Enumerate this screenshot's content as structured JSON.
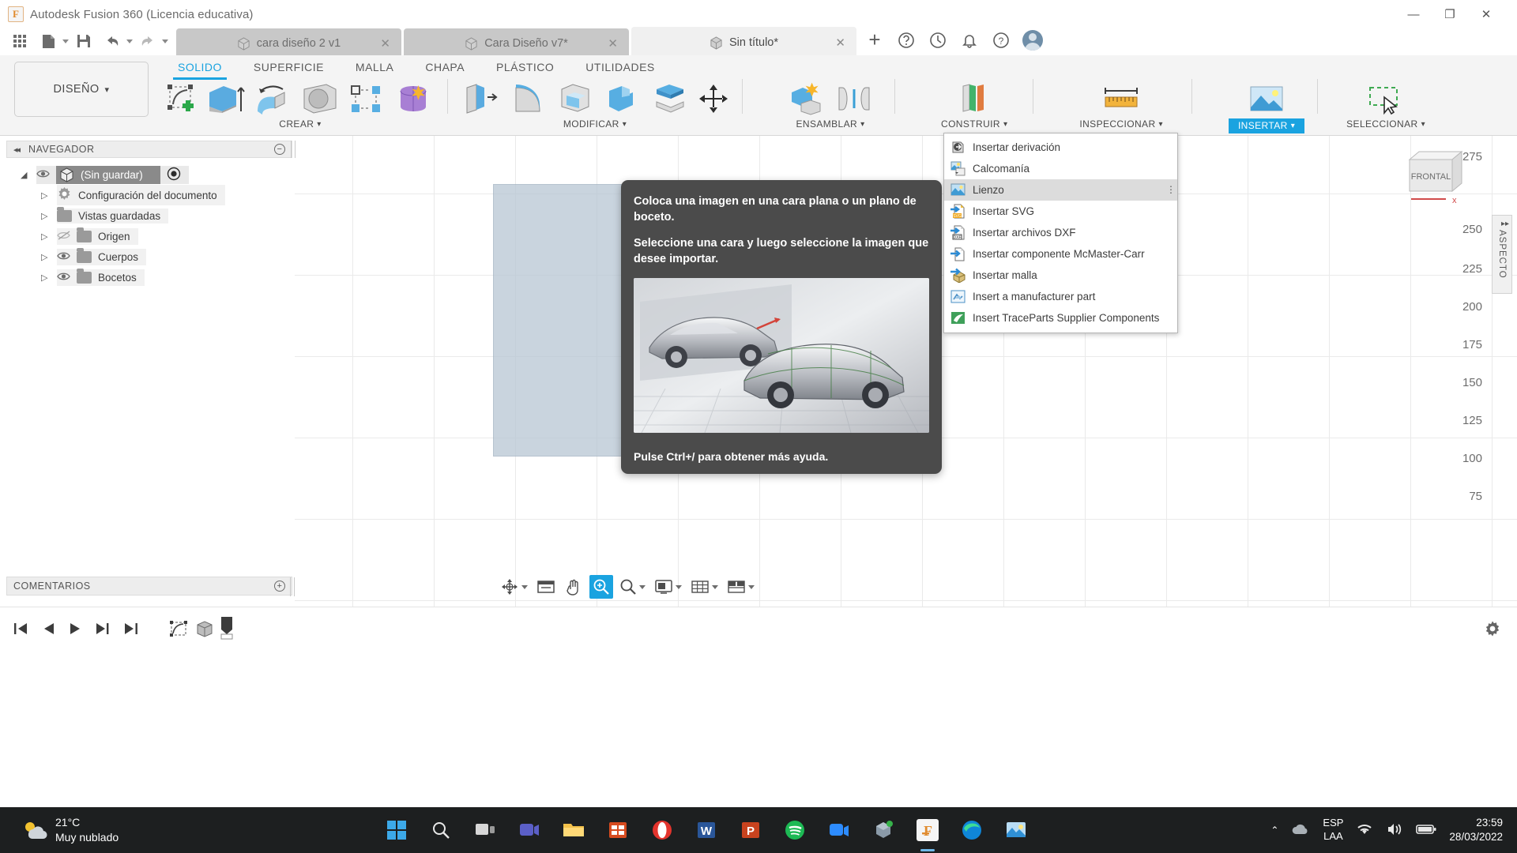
{
  "window": {
    "app_title": "Autodesk Fusion 360 (Licencia educativa)",
    "logo_letter": "F",
    "minimize": "—",
    "maximize": "❐",
    "close": "✕"
  },
  "quick_access": {
    "grid": "app-grid-icon",
    "new": "new-file-icon",
    "save": "save-icon",
    "undo": "undo-icon",
    "redo": "redo-icon"
  },
  "doc_tabs": [
    {
      "label": "cara diseño 2 v1",
      "active": false,
      "close": "✕"
    },
    {
      "label": "Cara Diseño v7*",
      "active": false,
      "close": "✕"
    },
    {
      "label": "Sin título*",
      "active": true,
      "close": "✕"
    }
  ],
  "tab_actions": {
    "new_tab": "+",
    "help_circle": "?",
    "history": "history-icon",
    "notifications": "bell-icon",
    "help": "help-icon",
    "account": "avatar"
  },
  "workspace": {
    "label": "DISEÑO",
    "caret": "▾"
  },
  "ribbon_tabs": [
    {
      "label": "SOLIDO",
      "active": true
    },
    {
      "label": "SUPERFICIE",
      "active": false
    },
    {
      "label": "MALLA",
      "active": false
    },
    {
      "label": "CHAPA",
      "active": false
    },
    {
      "label": "PLÁSTICO",
      "active": false
    },
    {
      "label": "UTILIDADES",
      "active": false
    }
  ],
  "ribbon_groups": [
    {
      "label": "CREAR",
      "caret": "▾",
      "highlight": false
    },
    {
      "label": "MODIFICAR",
      "caret": "▾",
      "highlight": false
    },
    {
      "label": "ENSAMBLAR",
      "caret": "▾",
      "highlight": false
    },
    {
      "label": "CONSTRUIR",
      "caret": "▾",
      "highlight": false
    },
    {
      "label": "INSPECCIONAR",
      "caret": "▾",
      "highlight": false
    },
    {
      "label": "INSERTAR",
      "caret": "▾",
      "highlight": true
    },
    {
      "label": "SELECCIONAR",
      "caret": "▾",
      "highlight": false
    }
  ],
  "browser": {
    "title": "NAVEGADOR",
    "collapse": "◂◂",
    "minimize": "−",
    "root": "(Sin guardar)",
    "items": [
      {
        "label": "Configuración del documento",
        "icon": "gear-icon",
        "hidden": false
      },
      {
        "label": "Vistas guardadas",
        "icon": "folder-icon",
        "hidden": false
      },
      {
        "label": "Origen",
        "icon": "folder-icon",
        "hidden": true
      },
      {
        "label": "Cuerpos",
        "icon": "folder-icon",
        "hidden": false
      },
      {
        "label": "Bocetos",
        "icon": "folder-icon",
        "hidden": false
      }
    ]
  },
  "comments": {
    "title": "COMENTARIOS",
    "add": "+"
  },
  "insert_menu": {
    "items": [
      {
        "label": "Insertar derivación",
        "icon": "insert-derive-icon",
        "selected": false,
        "overflow": ""
      },
      {
        "label": "Calcomanía",
        "icon": "decal-icon",
        "selected": false,
        "overflow": ""
      },
      {
        "label": "Lienzo",
        "icon": "canvas-image-icon",
        "selected": true,
        "overflow": "⋮"
      },
      {
        "label": "Insertar SVG",
        "icon": "svg-file-icon",
        "selected": false,
        "overflow": ""
      },
      {
        "label": "Insertar archivos DXF",
        "icon": "dxf-file-icon",
        "selected": false,
        "overflow": ""
      },
      {
        "label": "Insertar componente McMaster-Carr",
        "icon": "mcmaster-icon",
        "selected": false,
        "overflow": ""
      },
      {
        "label": "Insertar malla",
        "icon": "mesh-icon",
        "selected": false,
        "overflow": ""
      },
      {
        "label": "Insert a manufacturer part",
        "icon": "manufacturer-part-icon",
        "selected": false,
        "overflow": ""
      },
      {
        "label": "Insert TraceParts Supplier Components",
        "icon": "traceparts-icon",
        "selected": false,
        "overflow": ""
      }
    ]
  },
  "tooltip": {
    "line1": "Coloca una imagen en una cara plana o un plano de boceto.",
    "line2": "Seleccione una cara y luego seleccione la imagen que desee importar.",
    "footer": "Pulse Ctrl+/ para obtener más ayuda."
  },
  "viewport": {
    "ruler_ticks": [
      "275",
      "250",
      "225",
      "200",
      "175",
      "150",
      "125",
      "100",
      "75"
    ],
    "viewcube_face": "FRONTAL",
    "axis_label": "x",
    "aspect_panel": "ASPECTO",
    "aspect_collapse": "▸▸"
  },
  "navbar": [
    {
      "name": "orbit-icon",
      "active": false,
      "caret": true
    },
    {
      "name": "pan-view-icon",
      "active": false,
      "caret": false
    },
    {
      "name": "hand-pan-icon",
      "active": false,
      "caret": false
    },
    {
      "name": "zoom-window-icon",
      "active": true,
      "caret": false
    },
    {
      "name": "zoom-icon",
      "active": false,
      "caret": true
    },
    {
      "name": "display-settings-icon",
      "active": false,
      "caret": true
    },
    {
      "name": "grid-snaps-icon",
      "active": false,
      "caret": true
    },
    {
      "name": "viewports-icon",
      "active": false,
      "caret": true
    }
  ],
  "timeline": {
    "controls": [
      "go-to-start",
      "step-back",
      "play",
      "step-forward",
      "go-to-end"
    ],
    "markers": [
      "sketch-marker",
      "body-marker",
      "canvas-marker"
    ],
    "settings": "gear-icon"
  },
  "taskbar": {
    "temperature": "21°C",
    "weather": "Muy nublado",
    "apps": [
      "windows-start-icon",
      "search-icon",
      "task-view-icon",
      "teams-icon",
      "file-explorer-icon",
      "excel-icon",
      "opera-icon",
      "word-icon",
      "powerpoint-icon",
      "spotify-icon",
      "zoom-app-icon",
      "unity-icon",
      "fusion360-icon",
      "edge-icon",
      "photos-icon"
    ],
    "tray_chevron": "⌃",
    "cloud": "cloud-icon",
    "lang_line1": "ESP",
    "lang_line2": "LAA",
    "wifi": "wifi-icon",
    "volume": "volume-icon",
    "battery": "battery-icon",
    "time": "23:59",
    "date": "28/03/2022"
  },
  "colors": {
    "accent": "#1aa3e0",
    "ribbon_bg": "#f4f4f4",
    "taskbar_bg": "#1d1f20",
    "tooltip_bg": "#4b4b4b",
    "sketch_plane": "#b8c6d4"
  }
}
